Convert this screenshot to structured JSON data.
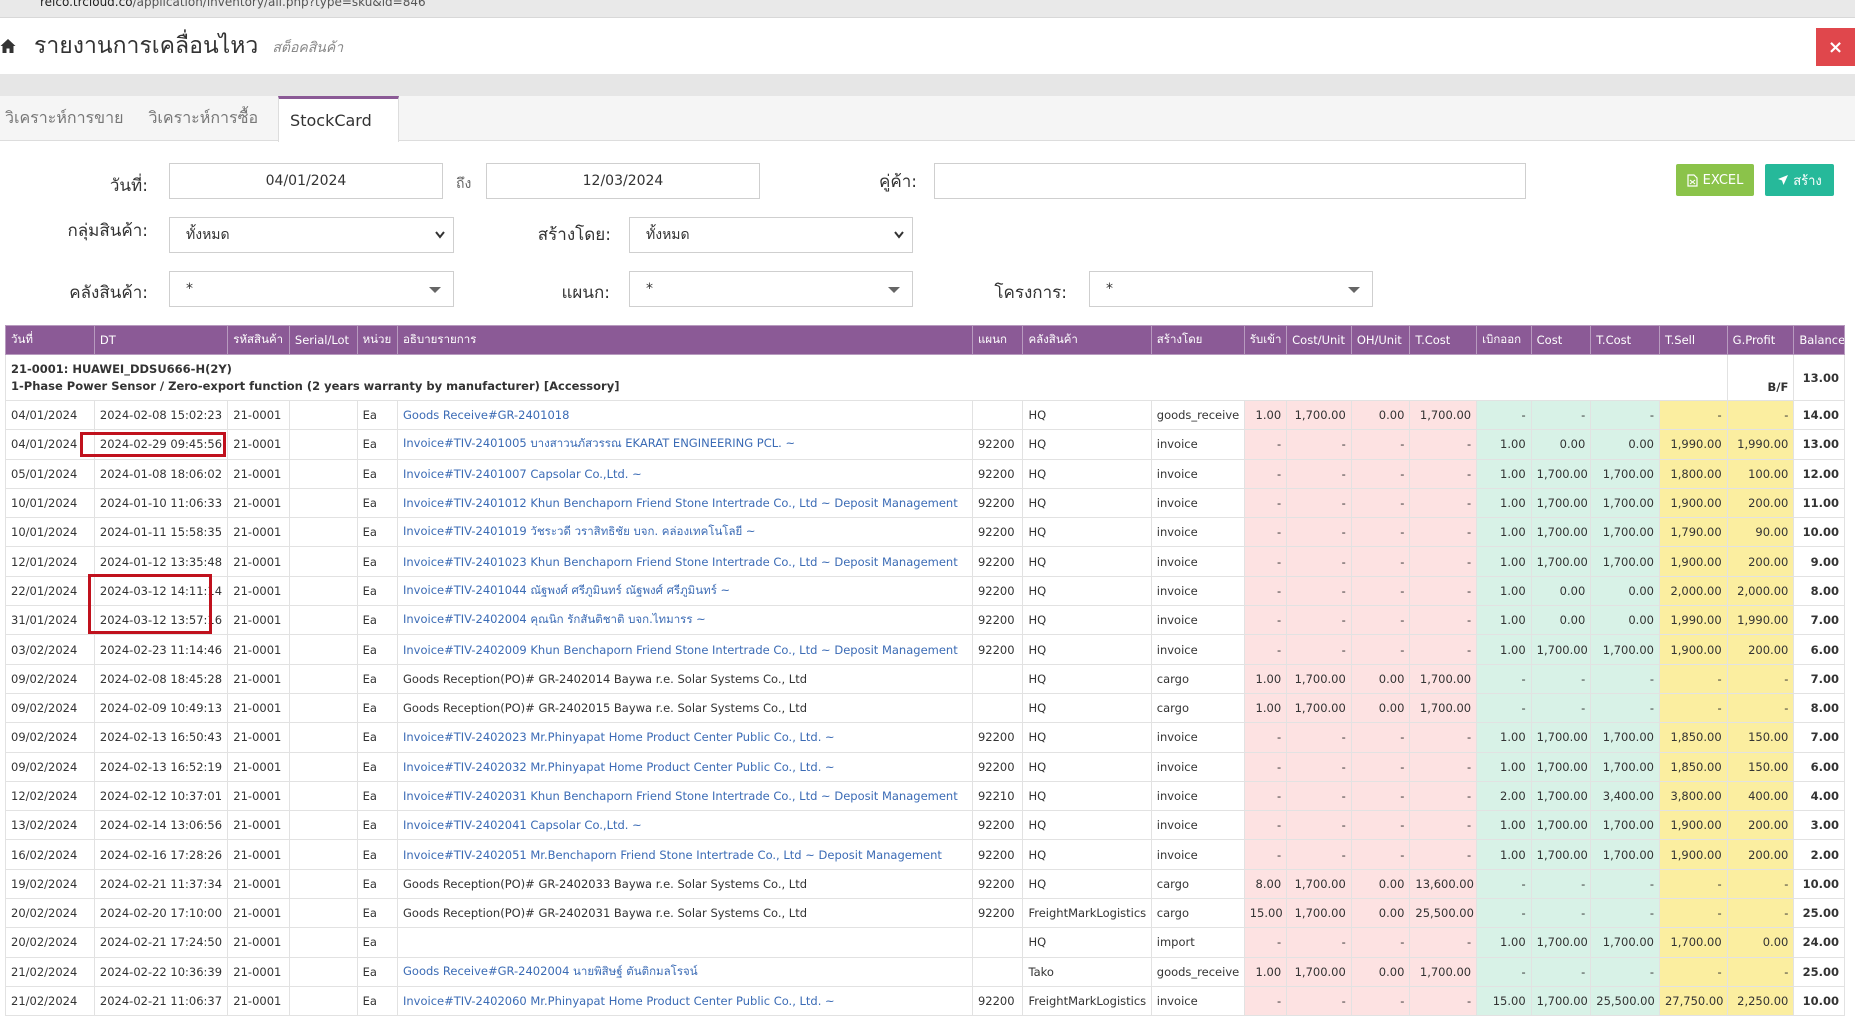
{
  "browser": {
    "url_host": "reico.trcloud.co",
    "url_path": "/application/inventory/all.php?type=sku&id=846"
  },
  "header": {
    "title": "รายงานการเคลื่อนไหว",
    "subtitle": "สต็อคสินค้า",
    "close_label": "×"
  },
  "tabs": [
    {
      "label": "วิเคราะห์การขาย",
      "active": false
    },
    {
      "label": "วิเคราะห์การซื้อ",
      "active": false
    },
    {
      "label": "StockCard",
      "active": true
    }
  ],
  "filters": {
    "date_label": "วันที่:",
    "date_from": "04/01/2024",
    "to_label": "ถึง",
    "date_to": "12/03/2024",
    "partner_label": "คู่ค้า:",
    "partner_value": "",
    "group_label": "กลุ่มสินค้า:",
    "group_value": "ทั้งหมด",
    "created_by_label": "สร้างโดย:",
    "created_by_value": "ทั้งหมด",
    "warehouse_label": "คลังสินค้า:",
    "warehouse_value": "*",
    "department_label": "แผนก:",
    "department_value": "*",
    "project_label": "โครงการ:",
    "project_value": "*"
  },
  "buttons": {
    "excel_label": "EXCEL",
    "create_label": "สร้าง"
  },
  "table": {
    "columns": [
      "วันที่",
      "DT",
      "รหัสสินค้า",
      "Serial/Lot",
      "หน่วย",
      "อธิบายรายการ",
      "แผนก",
      "คลังสินค้า",
      "สร้างโดย",
      "รับเข้า",
      "Cost/Unit",
      "OH/Unit",
      "T.Cost",
      "เบิกออก",
      "Cost",
      "T.Cost",
      "T.Sell",
      "G.Profit",
      "Balance"
    ],
    "group": {
      "line1": "21-0001: HUAWEI_DDSU666-H(2Y)",
      "line2": "1-Phase Power Sensor / Zero-export function (2 years warranty by manufacturer) [Accessory]",
      "bf_label": "B/F",
      "bf_balance": "13.00"
    },
    "rows": [
      [
        "04/01/2024",
        "2024-02-08 15:02:23",
        "21-0001",
        "",
        "Ea",
        "Goods Receive#GR-2401018",
        "",
        "HQ",
        "goods_receive",
        "1.00",
        "1,700.00",
        "0.00",
        "1,700.00",
        "-",
        "-",
        "-",
        "-",
        "-",
        "14.00"
      ],
      [
        "04/01/2024",
        "2024-02-29 09:45:56",
        "21-0001",
        "",
        "Ea",
        "Invoice#TIV-2401005 บางสาวนภัสวรรณ EKARAT ENGINEERING PCL. ~",
        "92200",
        "HQ",
        "invoice",
        "-",
        "-",
        "-",
        "-",
        "1.00",
        "0.00",
        "0.00",
        "1,990.00",
        "1,990.00",
        "13.00"
      ],
      [
        "05/01/2024",
        "2024-01-08 18:06:02",
        "21-0001",
        "",
        "Ea",
        "Invoice#TIV-2401007 Capsolar Co.,Ltd. ~",
        "92200",
        "HQ",
        "invoice",
        "-",
        "-",
        "-",
        "-",
        "1.00",
        "1,700.00",
        "1,700.00",
        "1,800.00",
        "100.00",
        "12.00"
      ],
      [
        "10/01/2024",
        "2024-01-10 11:06:33",
        "21-0001",
        "",
        "Ea",
        "Invoice#TIV-2401012 Khun Benchaporn Friend Stone Intertrade Co., Ltd ~ Deposit Management",
        "92200",
        "HQ",
        "invoice",
        "-",
        "-",
        "-",
        "-",
        "1.00",
        "1,700.00",
        "1,700.00",
        "1,900.00",
        "200.00",
        "11.00"
      ],
      [
        "10/01/2024",
        "2024-01-11 15:58:35",
        "21-0001",
        "",
        "Ea",
        "Invoice#TIV-2401019 วัชระวดี วราสิทธิชัย บจก. คล่องเทคโนโลยี ~",
        "92200",
        "HQ",
        "invoice",
        "-",
        "-",
        "-",
        "-",
        "1.00",
        "1,700.00",
        "1,700.00",
        "1,790.00",
        "90.00",
        "10.00"
      ],
      [
        "12/01/2024",
        "2024-01-12 13:35:48",
        "21-0001",
        "",
        "Ea",
        "Invoice#TIV-2401023 Khun Benchaporn Friend Stone Intertrade Co., Ltd ~ Deposit Management",
        "92200",
        "HQ",
        "invoice",
        "-",
        "-",
        "-",
        "-",
        "1.00",
        "1,700.00",
        "1,700.00",
        "1,900.00",
        "200.00",
        "9.00"
      ],
      [
        "22/01/2024",
        "2024-03-12 14:11:14",
        "21-0001",
        "",
        "Ea",
        "Invoice#TIV-2401044 ณัฐพงศ์ ศรีภูมินทร์ ณัฐพงศ์ ศรีภูมินทร์ ~",
        "92200",
        "HQ",
        "invoice",
        "-",
        "-",
        "-",
        "-",
        "1.00",
        "0.00",
        "0.00",
        "2,000.00",
        "2,000.00",
        "8.00"
      ],
      [
        "31/01/2024",
        "2024-03-12 13:57:16",
        "21-0001",
        "",
        "Ea",
        "Invoice#TIV-2402004 คุณนิก รักสันติชาติ บจก.ไทมารร ~",
        "92200",
        "HQ",
        "invoice",
        "-",
        "-",
        "-",
        "-",
        "1.00",
        "0.00",
        "0.00",
        "1,990.00",
        "1,990.00",
        "7.00"
      ],
      [
        "03/02/2024",
        "2024-02-23 11:14:46",
        "21-0001",
        "",
        "Ea",
        "Invoice#TIV-2402009 Khun Benchaporn Friend Stone Intertrade Co., Ltd ~ Deposit Management",
        "92200",
        "HQ",
        "invoice",
        "-",
        "-",
        "-",
        "-",
        "1.00",
        "1,700.00",
        "1,700.00",
        "1,900.00",
        "200.00",
        "6.00"
      ],
      [
        "09/02/2024",
        "2024-02-08 18:45:28",
        "21-0001",
        "",
        "Ea",
        "Goods Reception(PO)# GR-2402014 Baywa r.e. Solar Systems Co., Ltd",
        "",
        "HQ",
        "cargo",
        "1.00",
        "1,700.00",
        "0.00",
        "1,700.00",
        "-",
        "-",
        "-",
        "-",
        "-",
        "7.00"
      ],
      [
        "09/02/2024",
        "2024-02-09 10:49:13",
        "21-0001",
        "",
        "Ea",
        "Goods Reception(PO)# GR-2402015 Baywa r.e. Solar Systems Co., Ltd",
        "",
        "HQ",
        "cargo",
        "1.00",
        "1,700.00",
        "0.00",
        "1,700.00",
        "-",
        "-",
        "-",
        "-",
        "-",
        "8.00"
      ],
      [
        "09/02/2024",
        "2024-02-13 16:50:43",
        "21-0001",
        "",
        "Ea",
        "Invoice#TIV-2402023 Mr.Phinyapat Home Product Center Public Co., Ltd. ~",
        "92200",
        "HQ",
        "invoice",
        "-",
        "-",
        "-",
        "-",
        "1.00",
        "1,700.00",
        "1,700.00",
        "1,850.00",
        "150.00",
        "7.00"
      ],
      [
        "09/02/2024",
        "2024-02-13 16:52:19",
        "21-0001",
        "",
        "Ea",
        "Invoice#TIV-2402032 Mr.Phinyapat Home Product Center Public Co., Ltd. ~",
        "92200",
        "HQ",
        "invoice",
        "-",
        "-",
        "-",
        "-",
        "1.00",
        "1,700.00",
        "1,700.00",
        "1,850.00",
        "150.00",
        "6.00"
      ],
      [
        "12/02/2024",
        "2024-02-12 10:37:01",
        "21-0001",
        "",
        "Ea",
        "Invoice#TIV-2402031 Khun Benchaporn Friend Stone Intertrade Co., Ltd ~ Deposit Management",
        "92210",
        "HQ",
        "invoice",
        "-",
        "-",
        "-",
        "-",
        "2.00",
        "1,700.00",
        "3,400.00",
        "3,800.00",
        "400.00",
        "4.00"
      ],
      [
        "13/02/2024",
        "2024-02-14 13:06:56",
        "21-0001",
        "",
        "Ea",
        "Invoice#TIV-2402041 Capsolar Co.,Ltd. ~",
        "92200",
        "HQ",
        "invoice",
        "-",
        "-",
        "-",
        "-",
        "1.00",
        "1,700.00",
        "1,700.00",
        "1,900.00",
        "200.00",
        "3.00"
      ],
      [
        "16/02/2024",
        "2024-02-16 17:28:26",
        "21-0001",
        "",
        "Ea",
        "Invoice#TIV-2402051 Mr.Benchaporn Friend Stone Intertrade Co., Ltd ~ Deposit Management",
        "92200",
        "HQ",
        "invoice",
        "-",
        "-",
        "-",
        "-",
        "1.00",
        "1,700.00",
        "1,700.00",
        "1,900.00",
        "200.00",
        "2.00"
      ],
      [
        "19/02/2024",
        "2024-02-21 11:37:34",
        "21-0001",
        "",
        "Ea",
        "Goods Reception(PO)# GR-2402033 Baywa r.e. Solar Systems Co., Ltd",
        "92200",
        "HQ",
        "cargo",
        "8.00",
        "1,700.00",
        "0.00",
        "13,600.00",
        "-",
        "-",
        "-",
        "-",
        "-",
        "10.00"
      ],
      [
        "20/02/2024",
        "2024-02-20 17:10:00",
        "21-0001",
        "",
        "Ea",
        "Goods Reception(PO)# GR-2402031 Baywa r.e. Solar Systems Co., Ltd",
        "92200",
        "FreightMarkLogistics",
        "cargo",
        "15.00",
        "1,700.00",
        "0.00",
        "25,500.00",
        "-",
        "-",
        "-",
        "-",
        "-",
        "25.00"
      ],
      [
        "20/02/2024",
        "2024-02-21 17:24:50",
        "21-0001",
        "",
        "Ea",
        "",
        "",
        "HQ",
        "import",
        "-",
        "-",
        "-",
        "-",
        "1.00",
        "1,700.00",
        "1,700.00",
        "1,700.00",
        "0.00",
        "24.00"
      ],
      [
        "21/02/2024",
        "2024-02-22 10:36:39",
        "21-0001",
        "",
        "Ea",
        "Goods Receive#GR-2402004 นายพิสิษฐ์ ตันติกมลโรจน์",
        "",
        "Tako",
        "goods_receive",
        "1.00",
        "1,700.00",
        "0.00",
        "1,700.00",
        "-",
        "-",
        "-",
        "-",
        "-",
        "25.00"
      ],
      [
        "21/02/2024",
        "2024-02-21 11:06:37",
        "21-0001",
        "",
        "Ea",
        "Invoice#TIV-2402060 Mr.Phinyapat Home Product Center Public Co., Ltd. ~",
        "92200",
        "FreightMarkLogistics",
        "invoice",
        "-",
        "-",
        "-",
        "-",
        "15.00",
        "1,700.00",
        "25,500.00",
        "27,750.00",
        "2,250.00",
        "10.00"
      ]
    ]
  }
}
